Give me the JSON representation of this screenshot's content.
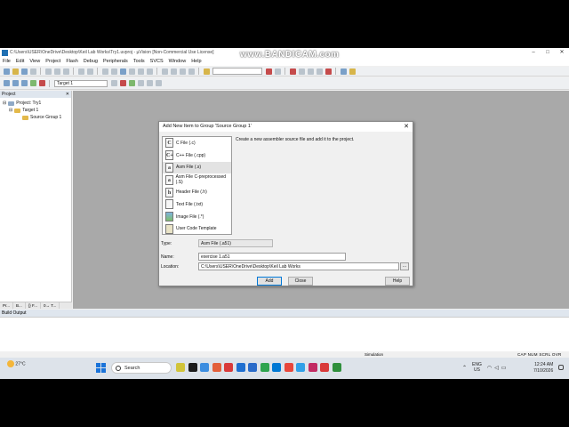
{
  "window": {
    "title": "C:\\Users\\USER\\OneDrive\\Desktop\\Keil Lab Works\\Try1.uvproj - µVision  [Non-Commercial Use License]",
    "controls": [
      "–",
      "□",
      "✕"
    ]
  },
  "watermark": "www.BANDICAM.com",
  "menu": [
    "File",
    "Edit",
    "View",
    "Project",
    "Flash",
    "Debug",
    "Peripherals",
    "Tools",
    "SVCS",
    "Window",
    "Help"
  ],
  "toolbar2": {
    "target": "Target 1"
  },
  "project_pane": {
    "title": "Project",
    "tree": {
      "root": "Project: Try1",
      "target": "Target 1",
      "group": "Source Group 1"
    },
    "tabs": [
      "Pr...",
      "B...",
      "{} F...",
      "0→ T..."
    ]
  },
  "dialog": {
    "title": "Add New Item to Group 'Source Group 1'",
    "close": "✕",
    "items": [
      {
        "icon": "C",
        "label": "C File (.c)"
      },
      {
        "icon": "C+",
        "label": "C++ File (.cpp)"
      },
      {
        "icon": "a",
        "label": "Asm File (.s)",
        "selected": true
      },
      {
        "icon": "a",
        "label": "Asm File C-preprocessed (.S)"
      },
      {
        "icon": "h",
        "label": "Header File (.h)"
      },
      {
        "icon": "",
        "label": "Text File (.txt)"
      },
      {
        "icon": "",
        "label": "Image File (.*)"
      },
      {
        "icon": "",
        "label": "User Code Template"
      }
    ],
    "description": "Create a new assembler source file and add it to the project.",
    "type_label": "Type:",
    "type_value": "Asm File (.a51)",
    "name_label": "Name:",
    "name_value": "exercise 1.a51",
    "location_label": "Location:",
    "location_value": "C:\\Users\\USER\\OneDrive\\Desktop\\Keil Lab Works",
    "browse": "...",
    "buttons": {
      "add": "Add",
      "close": "Close",
      "help": "Help"
    }
  },
  "build_output": {
    "title": "Build Output"
  },
  "status": {
    "mode": "Simulation",
    "indicators": "CAP  NUM  SCRL  OVR  R/W"
  },
  "taskbar": {
    "temperature": "27°C",
    "search": "Search",
    "lang_top": "ENG",
    "lang_bottom": "US",
    "time": "12:24 AM",
    "date": "7/10/2026",
    "app_colors": [
      "#d1c43a",
      "#1b1b1b",
      "#3b8de0",
      "#e35f3a",
      "#d93a3a",
      "#1f6fd0",
      "#2a6bc9",
      "#2ea44f",
      "#0078d4",
      "#e8463a",
      "#30a0e8",
      "#c22b63",
      "#d93a3a",
      "#2f8f3c"
    ]
  }
}
